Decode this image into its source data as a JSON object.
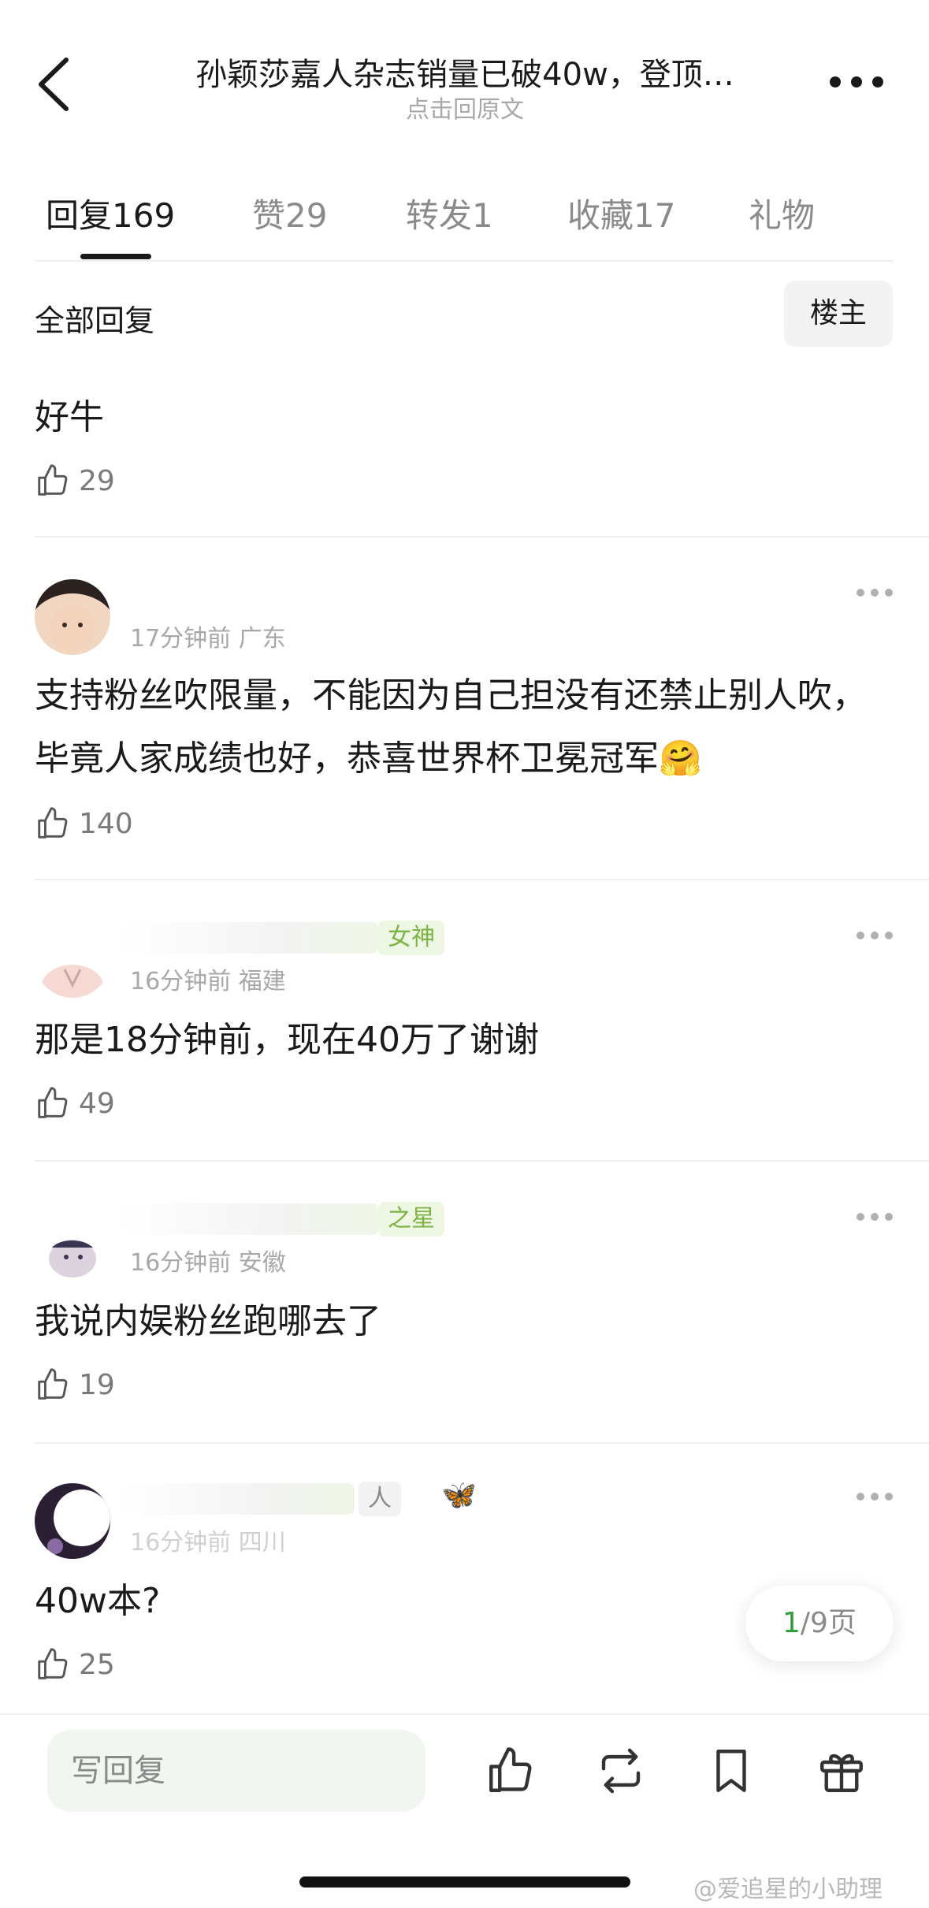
{
  "header": {
    "title": "孙颖莎嘉人杂志销量已破40w，登顶…",
    "subtitle": "点击回原文"
  },
  "tabs": [
    {
      "label": "回复",
      "count": "169"
    },
    {
      "label": "赞",
      "count": "29"
    },
    {
      "label": "转发",
      "count": "1"
    },
    {
      "label": "收藏",
      "count": "17"
    },
    {
      "label": "礼物",
      "count": ""
    }
  ],
  "filter": {
    "label": "全部回复",
    "owner_button": "楼主"
  },
  "comments": [
    {
      "text": "好牛",
      "likes": "29"
    },
    {
      "meta": "17分钟前 广东",
      "text": "支持粉丝吹限量，不能因为自己担没有还禁止别人吹，毕竟人家成绩也好，恭喜世界杯卫冕冠军🤗",
      "likes": "140"
    },
    {
      "badge": "女神",
      "meta": "16分钟前 福建",
      "text": "那是18分钟前，现在40万了谢谢",
      "likes": "49"
    },
    {
      "badge": "之星",
      "meta": "16分钟前 安徽",
      "text": "我说内娱粉丝跑哪去了",
      "likes": "19"
    },
    {
      "badge": "人",
      "badge_emoji": "🦋",
      "meta": "16分钟前 四川",
      "text": "40w本?",
      "likes": "25"
    }
  ],
  "pager": {
    "current": "1",
    "total": "/9页"
  },
  "bottom_bar": {
    "reply_placeholder": "写回复"
  },
  "watermark": "@爱追星的小助理",
  "colors": {
    "accent_green": "#2e9e3a",
    "badge_green": "#7cb342",
    "text_primary": "#1a1a1a",
    "text_secondary": "#a8a8a8"
  }
}
